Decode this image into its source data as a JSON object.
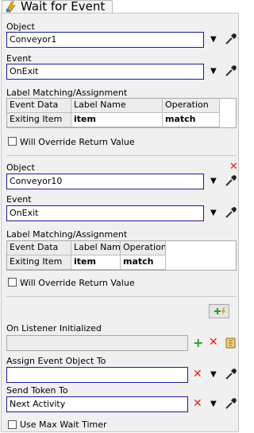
{
  "header": {
    "title": "Wait for Event"
  },
  "events": [
    {
      "object_label": "Object",
      "object_value": "Conveyor1",
      "event_label": "Event",
      "event_value": "OnExit",
      "matching_label": "Label Matching/Assignment",
      "columns": [
        "Event Data",
        "Label Name",
        "Operation"
      ],
      "row": [
        "Exiting Item",
        "item",
        "match"
      ],
      "override_label": "Will Override Return Value"
    },
    {
      "object_label": "Object",
      "object_value": "Conveyor10",
      "event_label": "Event",
      "event_value": "OnExit",
      "matching_label": "Label Matching/Assignment",
      "columns": [
        "Event Data",
        "Label Name",
        "Operation"
      ],
      "row": [
        "Exiting Item",
        "item",
        "match"
      ],
      "override_label": "Will Override Return Value"
    }
  ],
  "listener": {
    "label": "On Listener Initialized",
    "value": ""
  },
  "assign": {
    "label": "Assign Event Object To",
    "value": ""
  },
  "send_token": {
    "label": "Send Token To",
    "value": "Next Activity"
  },
  "max_wait": {
    "label": "Use Max Wait Timer"
  },
  "icons": {
    "dropdown": "chevron-down-icon",
    "picker": "eyedropper-icon",
    "remove": "red-x-icon",
    "add": "green-plus-icon"
  }
}
